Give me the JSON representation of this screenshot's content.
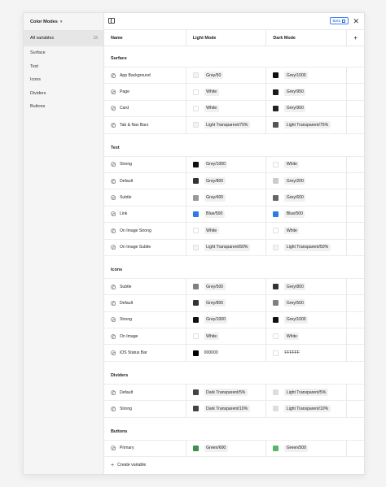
{
  "sidebar": {
    "title": "Color Modes",
    "all_label": "All variables",
    "all_count": "18",
    "items": [
      "Surface",
      "Text",
      "Icons",
      "Dividers",
      "Buttons"
    ]
  },
  "topbar": {
    "beta_label": "Beta",
    "close_icon": "close-icon"
  },
  "columns": {
    "name": "Name",
    "light": "Light Mode",
    "dark": "Dark Mode",
    "add": "+"
  },
  "groups": [
    {
      "name": "Surface",
      "rows": [
        {
          "name": "App Background",
          "light": {
            "label": "Grey/50",
            "color": "#f3f3f3",
            "pill": true
          },
          "dark": {
            "label": "Grey/1000",
            "color": "#111111",
            "pill": true
          }
        },
        {
          "name": "Page",
          "light": {
            "label": "White",
            "color": "#ffffff",
            "pill": true
          },
          "dark": {
            "label": "Grey/950",
            "color": "#1a1a1a",
            "pill": true
          }
        },
        {
          "name": "Card",
          "light": {
            "label": "White",
            "color": "#ffffff",
            "pill": true
          },
          "dark": {
            "label": "Grey/900",
            "color": "#222222",
            "pill": true
          }
        },
        {
          "name": "Tab & Nav Bars",
          "light": {
            "label": "Light Transparent/75%",
            "color": "#f2f2f2",
            "pill": true
          },
          "dark": {
            "label": "Light Transparent/75%",
            "color": "#555555",
            "pill": true
          }
        }
      ]
    },
    {
      "name": "Text",
      "rows": [
        {
          "name": "Strong",
          "light": {
            "label": "Grey/1000",
            "color": "#111111",
            "pill": true
          },
          "dark": {
            "label": "White",
            "color": "#ffffff",
            "pill": true
          }
        },
        {
          "name": "Default",
          "light": {
            "label": "Grey/800",
            "color": "#333333",
            "pill": true
          },
          "dark": {
            "label": "Grey/200",
            "color": "#cccccc",
            "pill": true
          }
        },
        {
          "name": "Subtle",
          "light": {
            "label": "Grey/400",
            "color": "#999999",
            "pill": true
          },
          "dark": {
            "label": "Grey/600",
            "color": "#666666",
            "pill": true
          }
        },
        {
          "name": "Link",
          "light": {
            "label": "Blue/500",
            "color": "#2d7be5",
            "pill": true
          },
          "dark": {
            "label": "Blue/500",
            "color": "#2d7be5",
            "pill": true
          }
        },
        {
          "name": "On Image Strong",
          "light": {
            "label": "White",
            "color": "#ffffff",
            "pill": true
          },
          "dark": {
            "label": "White",
            "color": "#ffffff",
            "pill": true
          }
        },
        {
          "name": "On Image Subtle",
          "light": {
            "label": "Light Transparent/50%",
            "color": "#f4f4f4",
            "pill": true
          },
          "dark": {
            "label": "Light Transparent/50%",
            "color": "#f4f4f4",
            "pill": true
          }
        }
      ]
    },
    {
      "name": "Icons",
      "rows": [
        {
          "name": "Subtle",
          "light": {
            "label": "Grey/500",
            "color": "#808080",
            "pill": true
          },
          "dark": {
            "label": "Grey/800",
            "color": "#333333",
            "pill": true
          }
        },
        {
          "name": "Default",
          "light": {
            "label": "Grey/800",
            "color": "#333333",
            "pill": true
          },
          "dark": {
            "label": "Grey/500",
            "color": "#808080",
            "pill": true
          }
        },
        {
          "name": "Strong",
          "light": {
            "label": "Grey/1000",
            "color": "#111111",
            "pill": true
          },
          "dark": {
            "label": "Grey/1000",
            "color": "#111111",
            "pill": true
          }
        },
        {
          "name": "On Image",
          "light": {
            "label": "White",
            "color": "#ffffff",
            "pill": true
          },
          "dark": {
            "label": "White",
            "color": "#ffffff",
            "pill": true
          }
        },
        {
          "name": "iOS Status Bar",
          "light": {
            "label": "000000",
            "color": "#000000",
            "pill": false
          },
          "dark": {
            "label": "FFFFFF",
            "color": "#ffffff",
            "pill": false
          }
        }
      ]
    },
    {
      "name": "Dividers",
      "rows": [
        {
          "name": "Default",
          "light": {
            "label": "Dark Transparent/5%",
            "color": "#444444",
            "pill": true
          },
          "dark": {
            "label": "Light Transparent/5%",
            "color": "#dddddd",
            "pill": true
          }
        },
        {
          "name": "Strong",
          "light": {
            "label": "Dark Transparent/10%",
            "color": "#444444",
            "pill": true
          },
          "dark": {
            "label": "Light Transparent/10%",
            "color": "#dddddd",
            "pill": true
          }
        }
      ]
    },
    {
      "name": "Buttons",
      "rows": [
        {
          "name": "Primary",
          "light": {
            "label": "Green/600",
            "color": "#3f8f4f",
            "pill": true
          },
          "dark": {
            "label": "Green/500",
            "color": "#58b766",
            "pill": true
          }
        }
      ]
    }
  ],
  "footer": {
    "label": "Create variable"
  }
}
